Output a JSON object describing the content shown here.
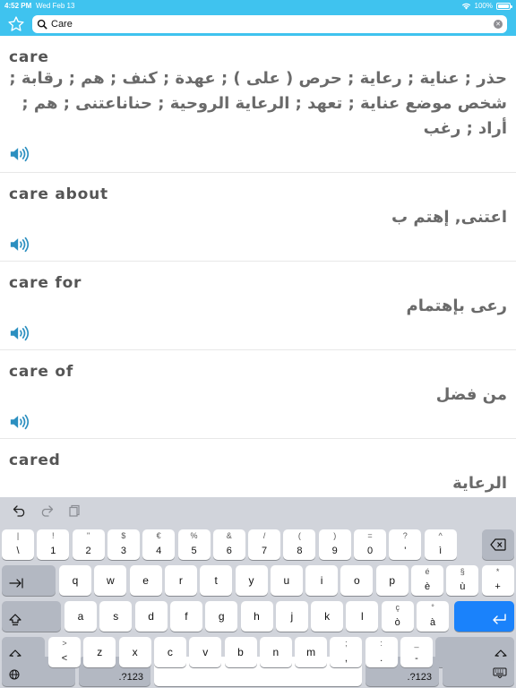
{
  "status": {
    "time": "4:52 PM",
    "date": "Wed Feb 13",
    "battery": "100%"
  },
  "search": {
    "value": "Care",
    "placeholder": ""
  },
  "entries": [
    {
      "term": "care",
      "translation": "حذر ; عناية ; رعاية ; حرص ( على ) ; عهدة ; كنف ; هم ; رقابة ; شخص موضع عناية ; تعهد ; الرعاية الروحية ; حناناعتنى ; هم ; أراد ; رغب"
    },
    {
      "term": "care about",
      "translation": "اعتنى, إهتم ب"
    },
    {
      "term": "care for",
      "translation": "رعى بإهتمام"
    },
    {
      "term": "care of",
      "translation": "من فضل"
    },
    {
      "term": "cared",
      "translation": "الرعاية"
    }
  ],
  "keyboard": {
    "row1": [
      {
        "sub": "|",
        "main": "\\"
      },
      {
        "sub": "!",
        "main": "1"
      },
      {
        "sub": "\"",
        "main": "2"
      },
      {
        "sub": "$",
        "main": "3"
      },
      {
        "sub": "€",
        "main": "4"
      },
      {
        "sub": "%",
        "main": "5"
      },
      {
        "sub": "&",
        "main": "6"
      },
      {
        "sub": "/",
        "main": "7"
      },
      {
        "sub": "(",
        "main": "8"
      },
      {
        "sub": ")",
        "main": "9"
      },
      {
        "sub": "=",
        "main": "0"
      },
      {
        "sub": "?",
        "main": "'"
      },
      {
        "sub": "^",
        "main": "ì"
      }
    ],
    "row2": [
      {
        "sub": "",
        "main": "q"
      },
      {
        "sub": "",
        "main": "w"
      },
      {
        "sub": "",
        "main": "e"
      },
      {
        "sub": "",
        "main": "r"
      },
      {
        "sub": "",
        "main": "t"
      },
      {
        "sub": "",
        "main": "y"
      },
      {
        "sub": "",
        "main": "u"
      },
      {
        "sub": "",
        "main": "i"
      },
      {
        "sub": "",
        "main": "o"
      },
      {
        "sub": "",
        "main": "p"
      },
      {
        "sub": "é",
        "main": "è"
      },
      {
        "sub": "§",
        "main": "ù"
      },
      {
        "sub": "*",
        "main": "+"
      }
    ],
    "row3": [
      {
        "sub": "",
        "main": "a"
      },
      {
        "sub": "",
        "main": "s"
      },
      {
        "sub": "",
        "main": "d"
      },
      {
        "sub": "",
        "main": "f"
      },
      {
        "sub": "",
        "main": "g"
      },
      {
        "sub": "",
        "main": "h"
      },
      {
        "sub": "",
        "main": "j"
      },
      {
        "sub": "",
        "main": "k"
      },
      {
        "sub": "",
        "main": "l"
      },
      {
        "sub": "ç",
        "main": "ò"
      },
      {
        "sub": "°",
        "main": "à"
      }
    ],
    "row4": [
      {
        "sub": ">",
        "main": "<"
      },
      {
        "sub": "",
        "main": "z"
      },
      {
        "sub": "",
        "main": "x"
      },
      {
        "sub": "",
        "main": "c"
      },
      {
        "sub": "",
        "main": "v"
      },
      {
        "sub": "",
        "main": "b"
      },
      {
        "sub": "",
        "main": "n"
      },
      {
        "sub": "",
        "main": "m"
      },
      {
        "sub": ";",
        "main": ","
      },
      {
        "sub": ":",
        "main": "."
      },
      {
        "sub": "_",
        "main": "-"
      }
    ],
    "numbers_label": ".?123"
  },
  "colors": {
    "accent": "#3fc3ef",
    "speaker": "#2b8fc0",
    "return_key": "#1a82fb"
  },
  "icons": [
    "star-icon",
    "search-icon",
    "clear-icon",
    "speaker-icon",
    "undo-icon",
    "redo-icon",
    "paste-icon",
    "delete-icon",
    "tab-icon",
    "caps-lock-icon",
    "return-icon",
    "shift-icon",
    "globe-icon",
    "keyboard-dismiss-icon"
  ]
}
